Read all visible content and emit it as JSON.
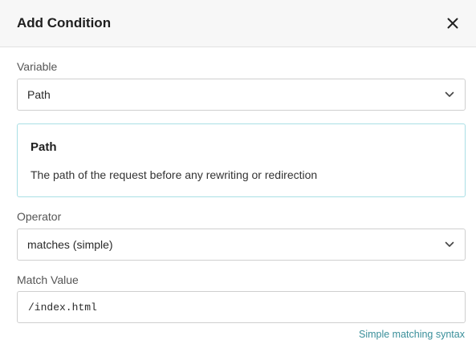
{
  "dialog": {
    "title": "Add Condition"
  },
  "variable": {
    "label": "Variable",
    "selected": "Path"
  },
  "info": {
    "title": "Path",
    "description": "The path of the request before any rewriting or redirection"
  },
  "operator": {
    "label": "Operator",
    "selected": "matches (simple)"
  },
  "match_value": {
    "label": "Match Value",
    "value": "/index.html"
  },
  "help": {
    "link_text": "Simple matching syntax"
  },
  "colors": {
    "header_bg": "#f7f7f7",
    "info_border": "#a9dfe5",
    "link": "#3a8f9a"
  },
  "icons": {
    "close": "close-icon",
    "chevron": "chevron-down-icon"
  }
}
